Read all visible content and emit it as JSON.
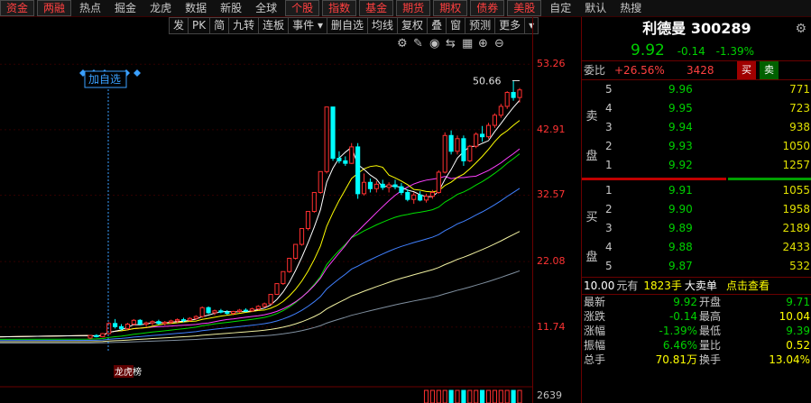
{
  "nav": {
    "items": [
      {
        "label": "资金",
        "style": "box"
      },
      {
        "label": "两融",
        "style": "box"
      },
      {
        "label": "热点",
        "style": "plain"
      },
      {
        "label": "掘金",
        "style": "plain"
      },
      {
        "label": "龙虎",
        "style": "plain"
      },
      {
        "label": "数据",
        "style": "plain"
      },
      {
        "label": "新股",
        "style": "plain"
      },
      {
        "label": "全球",
        "style": "plain"
      },
      {
        "label": "个股",
        "style": "box"
      },
      {
        "label": "指数",
        "style": "box"
      },
      {
        "label": "基金",
        "style": "box"
      },
      {
        "label": "期货",
        "style": "box"
      },
      {
        "label": "期权",
        "style": "box"
      },
      {
        "label": "债券",
        "style": "box"
      },
      {
        "label": "美股",
        "style": "box"
      },
      {
        "label": "自定",
        "style": "plain"
      },
      {
        "label": "默认",
        "style": "plain"
      },
      {
        "label": "热搜",
        "style": "plain"
      }
    ]
  },
  "toolbar": {
    "items": [
      "发",
      "PK",
      "简",
      "九转",
      "连板",
      "事件 ▾",
      "删自选",
      "均线",
      "复权",
      "叠",
      "窗",
      "预测",
      "更多",
      "▾"
    ]
  },
  "chart_icons": [
    "settings-icon",
    "draw-icon",
    "eye-icon",
    "compare-icon",
    "multi-icon",
    "zoom-in-icon",
    "zoom-out-icon"
  ],
  "chart_data": {
    "type": "candlestick",
    "price_ticks": [
      "53.26",
      "42.91",
      "32.57",
      "22.08",
      "11.74"
    ],
    "volume_tick": "2639",
    "high_marker": "50.66",
    "add_watch_label": "加自选",
    "bottom_tag": "龙虎榜",
    "colors": {
      "up": "#ff3030",
      "down": "#00ffff",
      "ma5": "#ffffff",
      "ma10": "#ffff00",
      "ma20": "#ff40ff",
      "ma30": "#00e000",
      "ma60": "#4080ff",
      "ma120": "#f0f0a0",
      "ma250": "#8090a0"
    },
    "candles": [
      [
        10.0,
        10.5,
        9.8,
        10.4
      ],
      [
        10.4,
        10.6,
        10.1,
        10.2
      ],
      [
        10.2,
        10.8,
        10.1,
        10.7
      ],
      [
        10.7,
        12.5,
        10.6,
        12.3
      ],
      [
        12.3,
        13.0,
        11.5,
        11.8
      ],
      [
        11.8,
        12.2,
        11.2,
        11.5
      ],
      [
        11.5,
        12.4,
        11.3,
        12.2
      ],
      [
        12.2,
        13.0,
        12.0,
        12.8
      ],
      [
        12.8,
        13.0,
        12.0,
        12.2
      ],
      [
        12.2,
        12.6,
        11.8,
        12.4
      ],
      [
        12.4,
        12.8,
        12.0,
        12.6
      ],
      [
        12.6,
        12.9,
        12.1,
        12.3
      ],
      [
        12.3,
        12.7,
        12.0,
        12.5
      ],
      [
        12.5,
        12.9,
        12.2,
        12.7
      ],
      [
        12.7,
        13.1,
        12.4,
        12.9
      ],
      [
        12.9,
        13.2,
        12.5,
        12.8
      ],
      [
        12.8,
        13.3,
        12.6,
        13.1
      ],
      [
        13.1,
        13.6,
        12.9,
        13.4
      ],
      [
        13.4,
        15.0,
        13.2,
        14.8
      ],
      [
        14.8,
        15.0,
        13.8,
        14.0
      ],
      [
        14.0,
        14.5,
        13.6,
        14.3
      ],
      [
        14.3,
        14.6,
        13.9,
        14.1
      ],
      [
        14.1,
        14.4,
        13.7,
        13.9
      ],
      [
        13.9,
        14.3,
        13.6,
        14.2
      ],
      [
        14.2,
        14.6,
        14.0,
        14.4
      ],
      [
        14.4,
        14.7,
        14.1,
        14.3
      ],
      [
        14.3,
        14.8,
        14.1,
        14.6
      ],
      [
        14.6,
        15.2,
        14.4,
        15.0
      ],
      [
        15.0,
        15.6,
        14.8,
        15.4
      ],
      [
        15.4,
        16.9,
        15.3,
        16.9
      ],
      [
        16.9,
        18.6,
        16.8,
        18.6
      ],
      [
        18.6,
        20.5,
        18.4,
        20.5
      ],
      [
        20.5,
        22.6,
        20.3,
        22.6
      ],
      [
        22.6,
        24.8,
        22.4,
        24.8
      ],
      [
        24.8,
        27.3,
        24.6,
        27.3
      ],
      [
        27.3,
        30.0,
        27.0,
        30.0
      ],
      [
        30.0,
        33.0,
        29.8,
        33.0
      ],
      [
        33.0,
        36.3,
        32.8,
        36.3
      ],
      [
        36.3,
        46.5,
        36.0,
        46.5
      ],
      [
        46.5,
        46.5,
        38.0,
        38.4
      ],
      [
        38.4,
        39.5,
        37.6,
        38.0
      ],
      [
        38.0,
        38.7,
        37.2,
        37.6
      ],
      [
        37.6,
        40.8,
        37.5,
        40.2
      ],
      [
        40.2,
        40.8,
        32.0,
        32.8
      ],
      [
        32.8,
        36.0,
        32.5,
        34.6
      ],
      [
        34.6,
        35.2,
        33.0,
        33.6
      ],
      [
        33.6,
        34.8,
        33.0,
        34.3
      ],
      [
        34.3,
        35.0,
        33.4,
        33.8
      ],
      [
        33.8,
        34.6,
        33.0,
        34.2
      ],
      [
        34.2,
        35.0,
        33.5,
        33.9
      ],
      [
        33.9,
        34.5,
        32.6,
        33.0
      ],
      [
        33.0,
        33.5,
        31.6,
        31.9
      ],
      [
        31.9,
        33.0,
        31.2,
        32.6
      ],
      [
        32.6,
        33.2,
        31.6,
        31.8
      ],
      [
        31.8,
        32.8,
        31.4,
        32.4
      ],
      [
        32.4,
        33.4,
        32.0,
        33.0
      ],
      [
        33.0,
        36.5,
        32.8,
        36.2
      ],
      [
        36.2,
        42.5,
        36.0,
        42.0
      ],
      [
        42.0,
        42.8,
        39.0,
        39.5
      ],
      [
        39.5,
        42.0,
        39.0,
        41.5
      ],
      [
        41.5,
        42.0,
        37.2,
        38.0
      ],
      [
        38.0,
        40.5,
        37.8,
        40.3
      ],
      [
        40.3,
        42.5,
        40.0,
        42.2
      ],
      [
        42.2,
        43.5,
        41.0,
        41.8
      ],
      [
        41.8,
        44.0,
        41.5,
        43.6
      ],
      [
        43.6,
        45.5,
        43.2,
        45.2
      ],
      [
        45.2,
        47.0,
        44.8,
        46.6
      ],
      [
        46.6,
        49.0,
        46.2,
        48.8
      ],
      [
        48.8,
        50.66,
        47.5,
        48.0
      ],
      [
        48.0,
        49.5,
        47.2,
        49.2
      ]
    ]
  },
  "quote": {
    "name": "利德曼",
    "code": "300289",
    "price": "9.92",
    "change": "-0.14",
    "change_pct": "-1.39%",
    "weibi_label": "委比",
    "weibi_pct": "+26.56%",
    "weibi_diff": "3428",
    "buy_btn": "买",
    "sell_btn": "卖",
    "sell_label": "卖盘",
    "buy_label": "买盘",
    "sell": [
      {
        "lv": "5",
        "px": "9.96",
        "vol": "771"
      },
      {
        "lv": "4",
        "px": "9.95",
        "vol": "723"
      },
      {
        "lv": "3",
        "px": "9.94",
        "vol": "938"
      },
      {
        "lv": "2",
        "px": "9.93",
        "vol": "1050"
      },
      {
        "lv": "1",
        "px": "9.92",
        "vol": "1257"
      }
    ],
    "buy": [
      {
        "lv": "1",
        "px": "9.91",
        "vol": "1055"
      },
      {
        "lv": "2",
        "px": "9.90",
        "vol": "1958"
      },
      {
        "lv": "3",
        "px": "9.89",
        "vol": "2189"
      },
      {
        "lv": "4",
        "px": "9.88",
        "vol": "2433"
      },
      {
        "lv": "5",
        "px": "9.87",
        "vol": "532"
      }
    ],
    "big_order": {
      "a": "10.00",
      "b": "元有",
      "c": "1823手",
      "d": "大卖单",
      "e": "点击查看"
    },
    "stats": [
      {
        "l1": "最新",
        "v1": "9.92",
        "c1": "g",
        "l2": "开盘",
        "v2": "9.71",
        "c2": "g"
      },
      {
        "l1": "涨跌",
        "v1": "-0.14",
        "c1": "g",
        "l2": "最高",
        "v2": "10.04",
        "c2": "y"
      },
      {
        "l1": "涨幅",
        "v1": "-1.39%",
        "c1": "g",
        "l2": "最低",
        "v2": "9.39",
        "c2": "g"
      },
      {
        "l1": "振幅",
        "v1": "6.46%",
        "c1": "g",
        "l2": "量比",
        "v2": "0.52",
        "c2": "y"
      },
      {
        "l1": "总手",
        "v1": "70.81万",
        "c1": "y",
        "l2": "换手",
        "v2": "13.04%",
        "c2": "y"
      }
    ]
  }
}
